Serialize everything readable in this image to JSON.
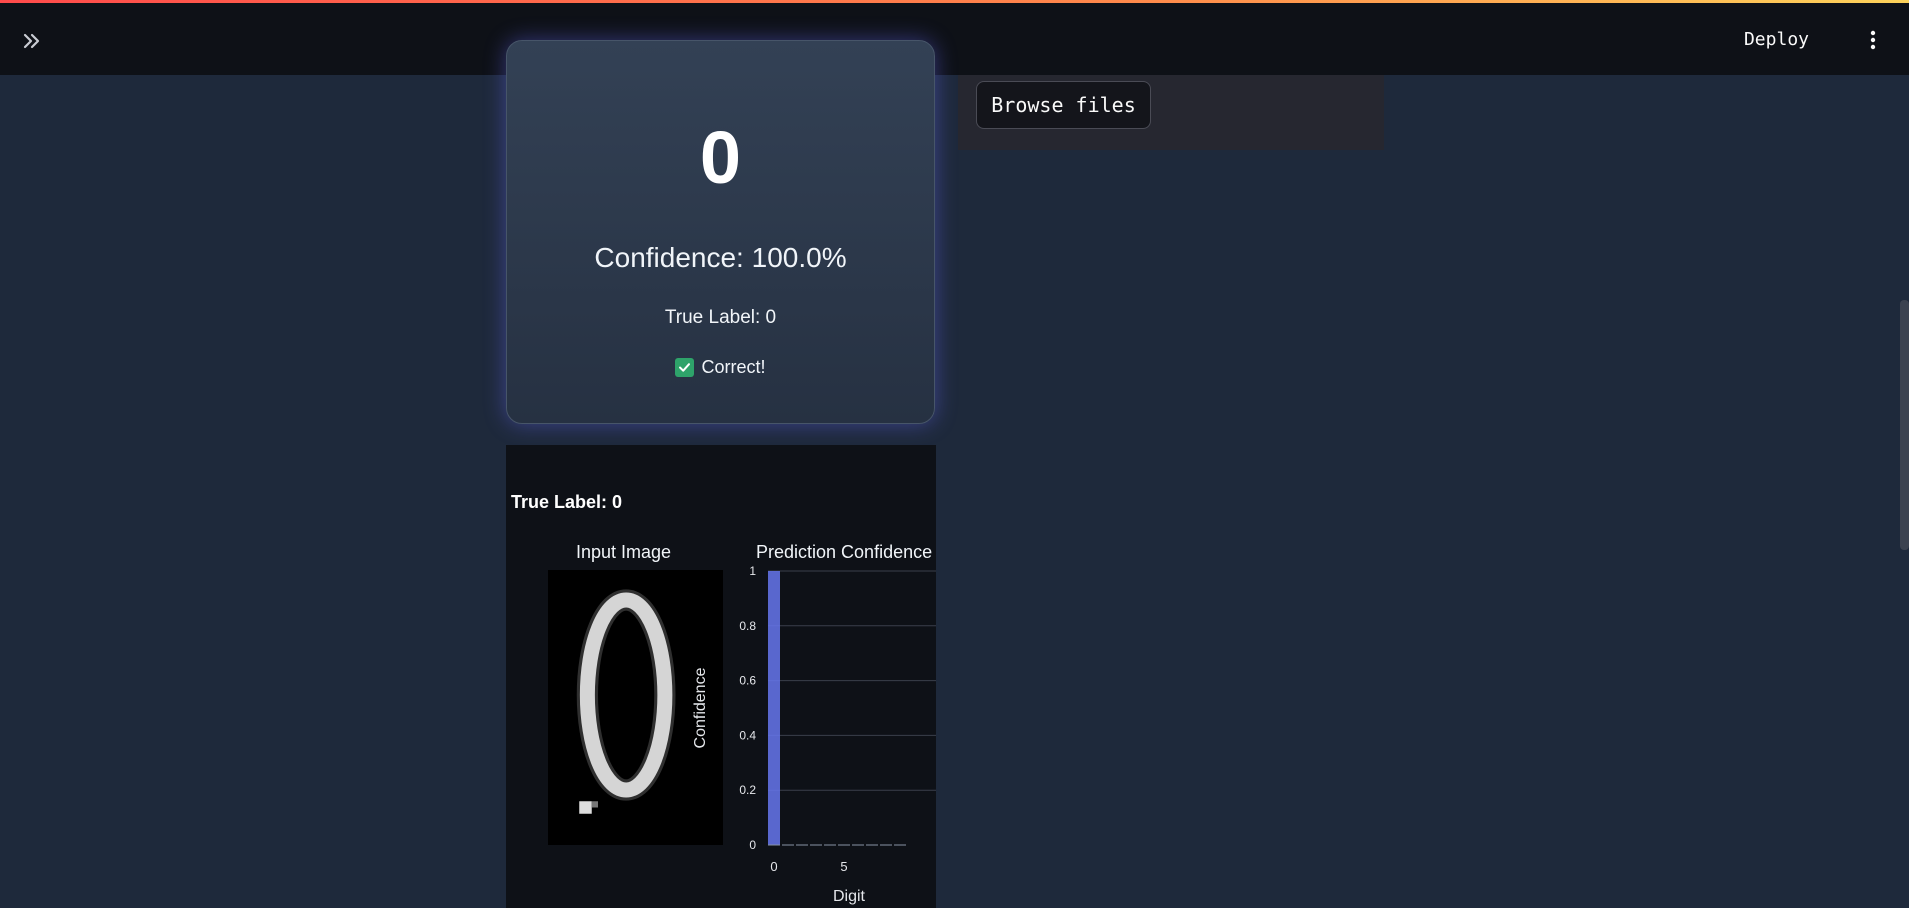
{
  "header": {
    "expand_icon": "double-chevron-right-icon",
    "deploy_label": "Deploy",
    "menu_icon": "vertical-ellipsis-icon"
  },
  "prediction_card": {
    "digit": "0",
    "confidence_text": "Confidence: 100.0%",
    "true_label_text": "True Label: 0",
    "status_icon": "check-mark-icon",
    "status_text": "Correct!"
  },
  "uploader": {
    "browse_label": "Browse files"
  },
  "figure": {
    "title": "True Label: 0",
    "image_title": "Input Image",
    "chart_title": "Prediction Confidence"
  },
  "chart_data": {
    "type": "bar",
    "title": "Prediction Confidence",
    "xlabel": "Digit",
    "ylabel": "Confidence",
    "x": [
      0,
      1,
      2,
      3,
      4,
      5,
      6,
      7,
      8,
      9
    ],
    "values": [
      1.0,
      0,
      0,
      0,
      0,
      0,
      0,
      0,
      0,
      0
    ],
    "ylim": [
      0,
      1
    ],
    "yticks": [
      "0",
      "0.2",
      "0.4",
      "0.6",
      "0.8",
      "1"
    ],
    "xticks": [
      "0",
      "5"
    ],
    "bar_color": "#6677ee",
    "grid": true
  },
  "colors": {
    "accent": "#6677ee",
    "success": "#2ea36a",
    "background": "#1e293b"
  }
}
